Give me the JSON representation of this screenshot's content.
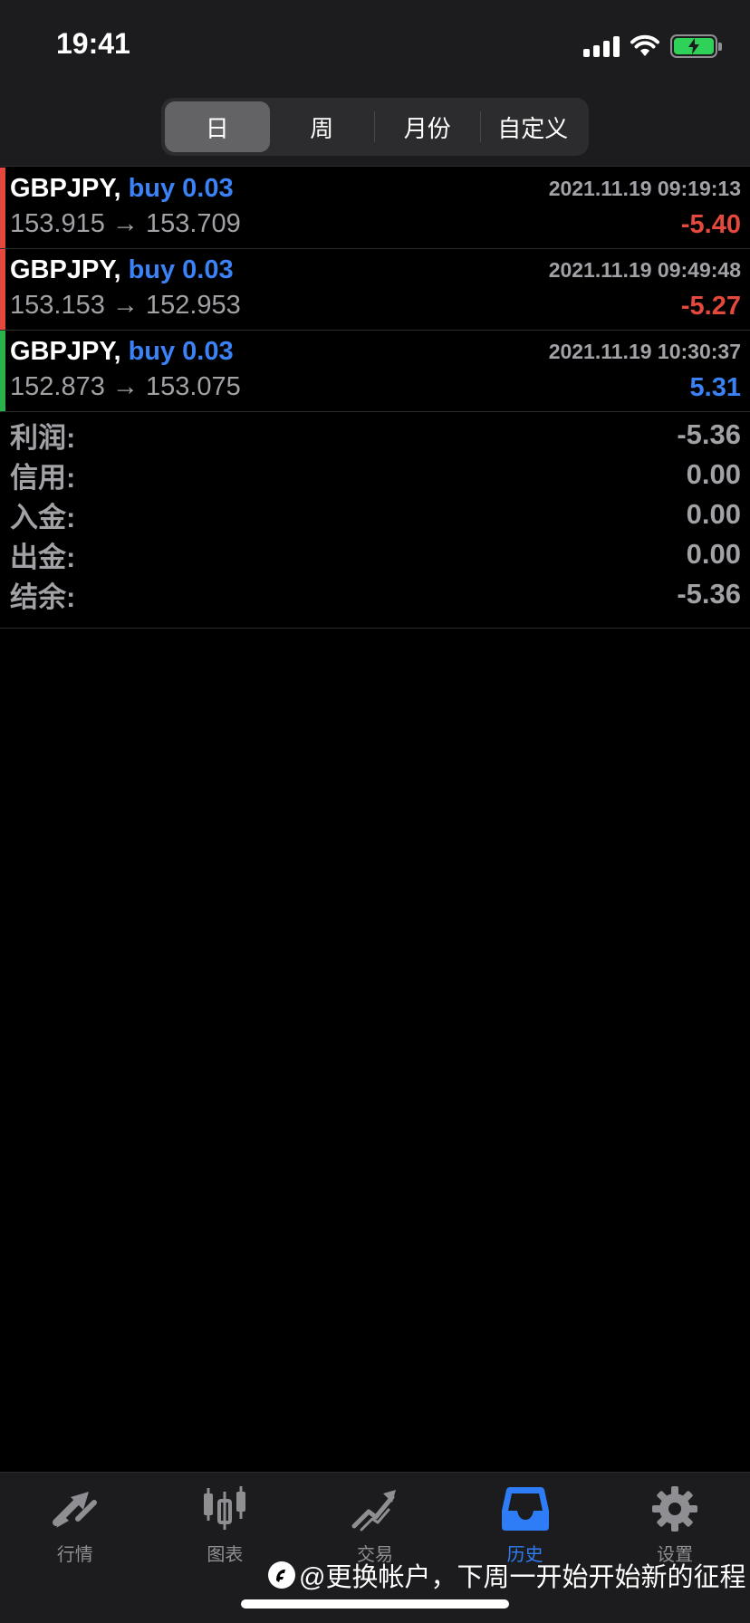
{
  "status_bar": {
    "time": "19:41"
  },
  "segmented": {
    "items": [
      "日",
      "周",
      "月份",
      "自定义"
    ],
    "selected": "日"
  },
  "deals": [
    {
      "symbol": "GBPJPY,",
      "action": "buy 0.03",
      "time": "2021.11.19 09:19:13",
      "prices": "153.915 → 153.709",
      "profit": "-5.40",
      "result": "loss"
    },
    {
      "symbol": "GBPJPY,",
      "action": "buy 0.03",
      "time": "2021.11.19 09:49:48",
      "prices": "153.153 → 152.953",
      "profit": "-5.27",
      "result": "loss"
    },
    {
      "symbol": "GBPJPY,",
      "action": "buy 0.03",
      "time": "2021.11.19 10:30:37",
      "prices": "152.873 → 153.075",
      "profit": "5.31",
      "result": "profit"
    }
  ],
  "summary": [
    {
      "label": "利润:",
      "value": "-5.36"
    },
    {
      "label": "信用:",
      "value": "0.00"
    },
    {
      "label": "入金:",
      "value": "0.00"
    },
    {
      "label": "出金:",
      "value": "0.00"
    },
    {
      "label": "结余:",
      "value": "-5.36"
    }
  ],
  "tabbar": {
    "items": [
      {
        "label": "行情",
        "icon": "quotes-arrows-icon"
      },
      {
        "label": "图表",
        "icon": "candlestick-chart-icon"
      },
      {
        "label": "交易",
        "icon": "trade-trend-icon"
      },
      {
        "label": "历史",
        "icon": "history-inbox-icon"
      },
      {
        "label": "设置",
        "icon": "gear-icon"
      }
    ],
    "active": "历史"
  },
  "watermark": {
    "text": "@更换帐户，下周一开始开始新的征程"
  },
  "colors": {
    "loss": "#e5483c",
    "profit": "#29b34a",
    "accent": "#3b82f6",
    "background": "#000000"
  }
}
